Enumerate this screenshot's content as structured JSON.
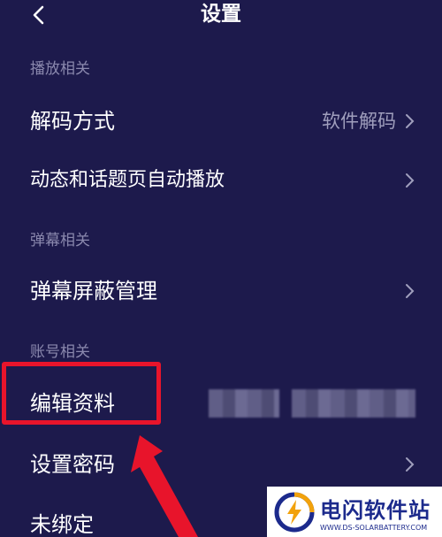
{
  "header": {
    "title": "设置"
  },
  "sections": {
    "playback": "播放相关",
    "danmaku": "弹幕相关",
    "account": "账号相关"
  },
  "rows": {
    "decode": {
      "label": "解码方式",
      "value": "软件解码"
    },
    "autoplay": {
      "label": "动态和话题页自动播放"
    },
    "danmaku_block": {
      "label": "弹幕屏蔽管理"
    },
    "edit_profile": {
      "label": "编辑资料"
    },
    "set_password": {
      "label": "设置密码"
    },
    "unbound": {
      "label": "未绑定"
    }
  },
  "watermark": {
    "title": "电闪软件站",
    "subtitle": "WWW.DS-SOLARBATTERY.COM"
  },
  "colors": {
    "background": "#1d1a4c",
    "section_text": "#8a88ad",
    "highlight": "#e8142b",
    "watermark_text": "#1c2a8c"
  },
  "icons": [
    "back-arrow-icon",
    "chevron-right-icon",
    "annotation-arrow-icon",
    "watermark-logo-icon"
  ]
}
